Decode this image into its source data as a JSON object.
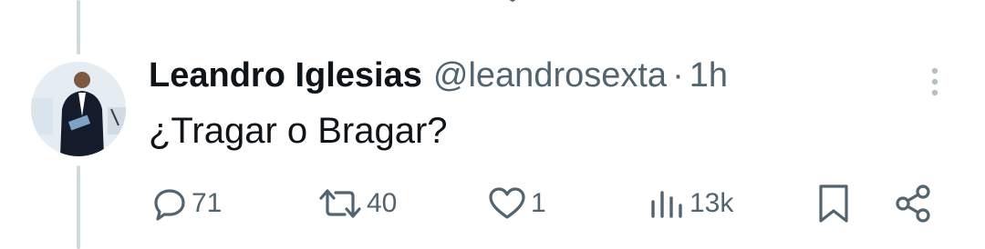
{
  "previous_tweet": {
    "actions": [
      "reply-icon",
      "retweet-icon",
      "like-icon",
      "views-icon",
      "bookmark-icon",
      "share-icon"
    ]
  },
  "tweet": {
    "author_name": "Leandro Iglesias",
    "handle": "@leandrosexta",
    "separator": "·",
    "time": "1h",
    "text": "¿Tragar o Bragar?",
    "actions": {
      "replies": "71",
      "retweets": "40",
      "likes": "1",
      "views": "13k"
    }
  },
  "colors": {
    "text_primary": "#0f1419",
    "text_secondary": "#536471",
    "thread_line": "#cfd9de"
  }
}
